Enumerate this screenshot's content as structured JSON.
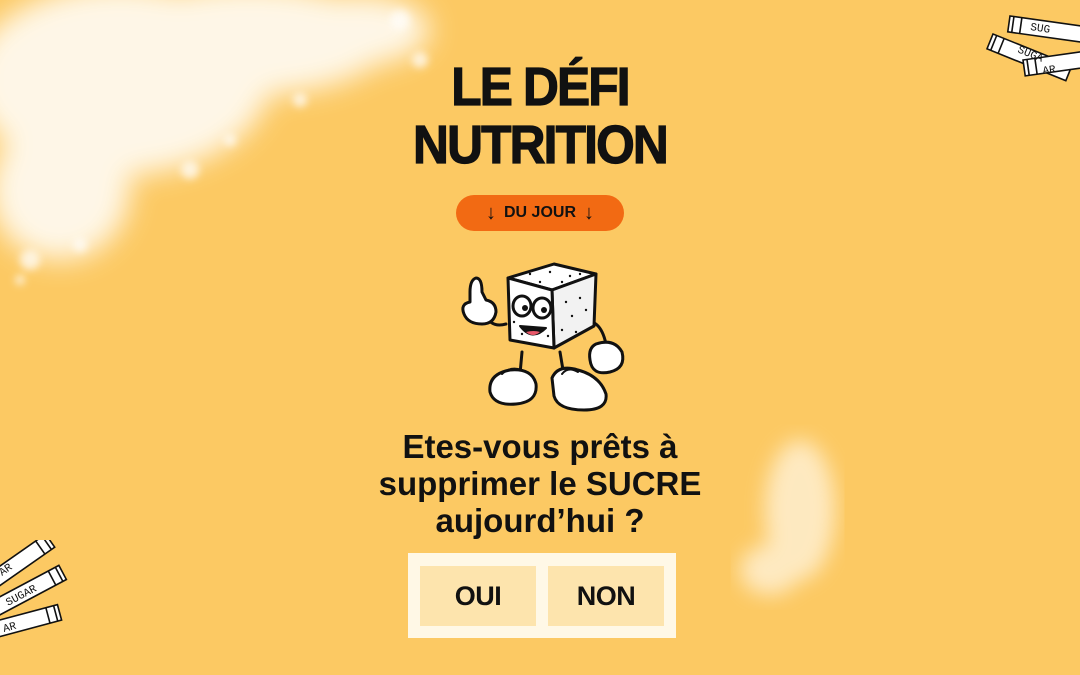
{
  "title": {
    "line1": "LE DÉFI",
    "line2": "NUTRITION"
  },
  "badge": {
    "label": "DU JOUR",
    "arrow_left": "↓",
    "arrow_right": "↓"
  },
  "mascot": {
    "icon": "sugar-cube-mascot-icon"
  },
  "question": {
    "line1": "Etes-vous prêts à",
    "line2": "supprimer le SUCRE",
    "line3": "aujourd’hui ?"
  },
  "choices": {
    "yes": "OUI",
    "no": "NON"
  },
  "decor": {
    "stick_top_1": "SUG",
    "stick_top_2": "SUGA",
    "stick_top_3": "AR",
    "stick_bottom_1": "AR",
    "stick_bottom_2": "SUGAR",
    "stick_bottom_3": "AR"
  },
  "colors": {
    "background": "#fcc963",
    "badge": "#f26a13",
    "button": "#fde4ad",
    "button_frame": "#fff8e6",
    "text": "#111111"
  }
}
